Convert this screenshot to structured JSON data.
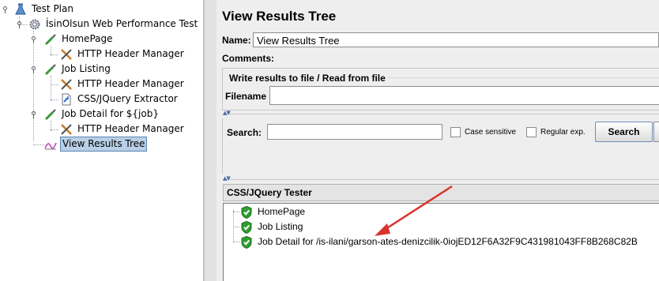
{
  "tree": {
    "items": [
      {
        "label": "Test Plan",
        "icon": "flask-icon"
      },
      {
        "label": "İsinOlsun Web Performance Test",
        "icon": "gear-icon"
      },
      {
        "label": "HomePage",
        "icon": "sampler-pipette-icon"
      },
      {
        "label": "HTTP Header Manager",
        "icon": "wrench-icon"
      },
      {
        "label": "Job Listing",
        "icon": "sampler-pipette-icon"
      },
      {
        "label": "HTTP Header Manager",
        "icon": "wrench-icon"
      },
      {
        "label": "CSS/JQuery Extractor",
        "icon": "document-arrow-icon"
      },
      {
        "label": "Job Detail for ${job}",
        "icon": "sampler-pipette-icon"
      },
      {
        "label": "HTTP Header Manager",
        "icon": "wrench-icon"
      },
      {
        "label": "View Results Tree",
        "icon": "chart-icon",
        "selected": true
      }
    ]
  },
  "panel": {
    "title": "View Results Tree",
    "name_label": "Name:",
    "name_value": "View Results Tree",
    "comments_label": "Comments:",
    "write_results_title": "Write results to file / Read from file",
    "filename_label": "Filename"
  },
  "search": {
    "label": "Search:",
    "value": "",
    "case_sensitive_label": "Case sensitive",
    "case_sensitive_checked": false,
    "regex_label": "Regular exp.",
    "regex_checked": false,
    "button_label": "Search"
  },
  "tester": {
    "title": "CSS/JQuery Tester",
    "results": [
      {
        "label": "HomePage",
        "status": "success"
      },
      {
        "label": "Job Listing",
        "status": "success"
      },
      {
        "label": "Job Detail for /is-ilani/garson-ates-denizcilik-0iojED12F6A32F9C431981043FF8B268C82B",
        "status": "success"
      }
    ]
  },
  "colors": {
    "selection_bg": "#b8cfe5",
    "success_green": "#2f9e2f",
    "annotation_arrow": "#d9342b"
  }
}
